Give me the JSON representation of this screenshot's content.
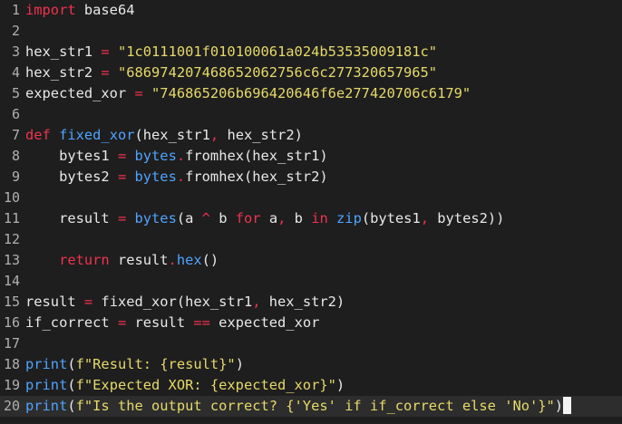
{
  "editor": {
    "current_line": 20,
    "lines": [
      {
        "n": "1",
        "tokens": [
          [
            "kw",
            "import"
          ],
          [
            "id",
            " base64"
          ]
        ]
      },
      {
        "n": "2",
        "tokens": []
      },
      {
        "n": "3",
        "tokens": [
          [
            "id",
            "hex_str1 "
          ],
          [
            "op",
            "="
          ],
          [
            "id",
            " "
          ],
          [
            "str",
            "\"1c0111001f010100061a024b53535009181c\""
          ]
        ]
      },
      {
        "n": "4",
        "tokens": [
          [
            "id",
            "hex_str2 "
          ],
          [
            "op",
            "="
          ],
          [
            "id",
            " "
          ],
          [
            "str",
            "\"686974207468652062756c6c277320657965\""
          ]
        ]
      },
      {
        "n": "5",
        "tokens": [
          [
            "id",
            "expected_xor "
          ],
          [
            "op",
            "="
          ],
          [
            "id",
            " "
          ],
          [
            "str",
            "\"746865206b696420646f6e277420706c6179\""
          ]
        ]
      },
      {
        "n": "6",
        "tokens": []
      },
      {
        "n": "7",
        "tokens": [
          [
            "kw",
            "def"
          ],
          [
            "id",
            " "
          ],
          [
            "fn",
            "fixed_xor"
          ],
          [
            "id",
            "(hex_str1"
          ],
          [
            "sep",
            ","
          ],
          [
            "id",
            " hex_str2)"
          ]
        ]
      },
      {
        "n": "8",
        "tokens": [
          [
            "id",
            "    bytes1 "
          ],
          [
            "op",
            "="
          ],
          [
            "id",
            " "
          ],
          [
            "fn",
            "bytes"
          ],
          [
            "sep",
            "."
          ],
          [
            "id",
            "fromhex(hex_str1)"
          ]
        ]
      },
      {
        "n": "9",
        "tokens": [
          [
            "id",
            "    bytes2 "
          ],
          [
            "op",
            "="
          ],
          [
            "id",
            " "
          ],
          [
            "fn",
            "bytes"
          ],
          [
            "sep",
            "."
          ],
          [
            "id",
            "fromhex(hex_str2)"
          ]
        ]
      },
      {
        "n": "10",
        "tokens": []
      },
      {
        "n": "11",
        "tokens": [
          [
            "id",
            "    result "
          ],
          [
            "op",
            "="
          ],
          [
            "id",
            " "
          ],
          [
            "fn",
            "bytes"
          ],
          [
            "id",
            "(a "
          ],
          [
            "op",
            "^"
          ],
          [
            "id",
            " b "
          ],
          [
            "kw",
            "for"
          ],
          [
            "id",
            " a"
          ],
          [
            "sep",
            ","
          ],
          [
            "id",
            " b "
          ],
          [
            "kw",
            "in"
          ],
          [
            "id",
            " "
          ],
          [
            "fn",
            "zip"
          ],
          [
            "id",
            "(bytes1"
          ],
          [
            "sep",
            ","
          ],
          [
            "id",
            " bytes2))"
          ]
        ]
      },
      {
        "n": "12",
        "tokens": []
      },
      {
        "n": "13",
        "tokens": [
          [
            "kw",
            "    return"
          ],
          [
            "id",
            " result"
          ],
          [
            "sep",
            "."
          ],
          [
            "fn",
            "hex"
          ],
          [
            "id",
            "()"
          ]
        ]
      },
      {
        "n": "14",
        "tokens": []
      },
      {
        "n": "15",
        "tokens": [
          [
            "id",
            "result "
          ],
          [
            "op",
            "="
          ],
          [
            "id",
            " fixed_xor(hex_str1"
          ],
          [
            "sep",
            ","
          ],
          [
            "id",
            " hex_str2)"
          ]
        ]
      },
      {
        "n": "16",
        "tokens": [
          [
            "id",
            "if_correct "
          ],
          [
            "op",
            "="
          ],
          [
            "id",
            " result "
          ],
          [
            "op",
            "=="
          ],
          [
            "id",
            " expected_xor"
          ]
        ]
      },
      {
        "n": "17",
        "tokens": []
      },
      {
        "n": "18",
        "tokens": [
          [
            "fn",
            "print"
          ],
          [
            "id",
            "("
          ],
          [
            "str",
            "f\"Result: {result}\""
          ],
          [
            "id",
            ")"
          ]
        ]
      },
      {
        "n": "19",
        "tokens": [
          [
            "fn",
            "print"
          ],
          [
            "id",
            "("
          ],
          [
            "str",
            "f\"Expected XOR: {expected_xor}\""
          ],
          [
            "id",
            ")"
          ]
        ]
      },
      {
        "n": "20",
        "tokens": [
          [
            "fn",
            "print"
          ],
          [
            "id",
            "("
          ],
          [
            "str",
            "f\"Is the output correct? {'Yes' if if_correct else 'No'}\""
          ],
          [
            "id",
            ")"
          ]
        ]
      }
    ]
  }
}
